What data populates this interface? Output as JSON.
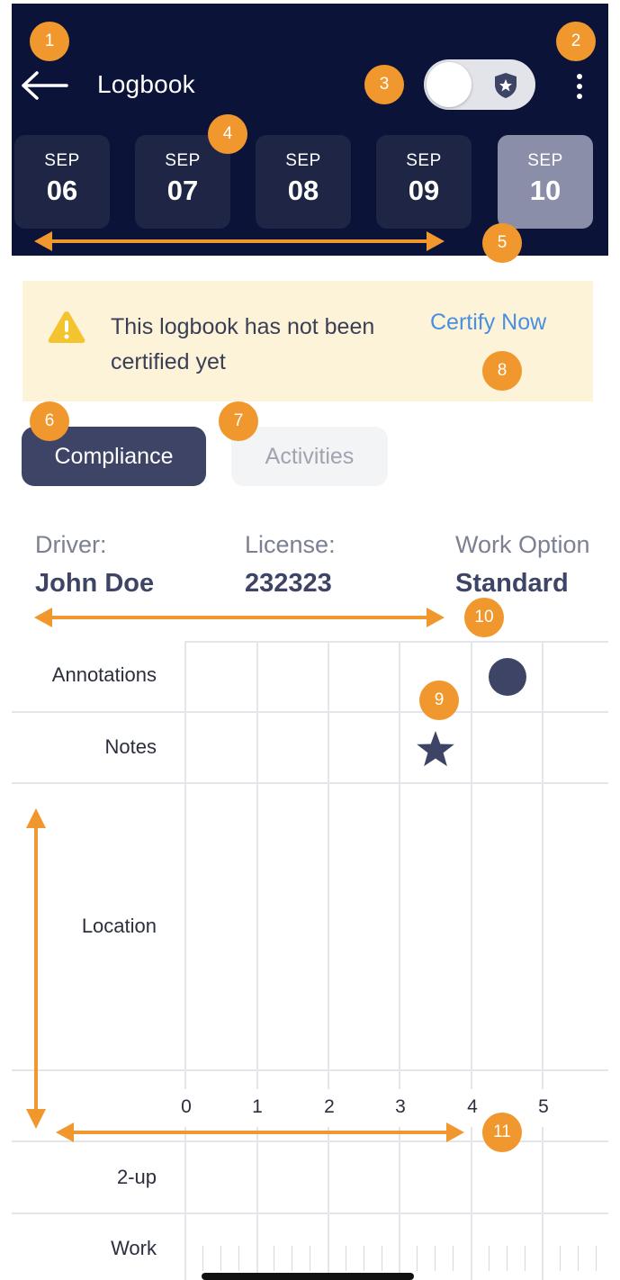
{
  "header": {
    "title": "Logbook",
    "bg_color": "#0c1338",
    "back_icon": "arrow-left-icon",
    "menu_icon": "kebab-menu-icon",
    "toggle": {
      "icon": "shield-star-icon",
      "state": "off"
    }
  },
  "dates": [
    {
      "month": "SEP",
      "day": "06",
      "selected": false
    },
    {
      "month": "SEP",
      "day": "07",
      "selected": false
    },
    {
      "month": "SEP",
      "day": "08",
      "selected": false
    },
    {
      "month": "SEP",
      "day": "09",
      "selected": false
    },
    {
      "month": "SEP",
      "day": "10",
      "selected": true
    }
  ],
  "banner": {
    "icon": "warning-icon",
    "message": "This logbook has not been certified yet",
    "action": "Certify Now",
    "bg_color": "#fcf3d9",
    "action_color": "#4a8fe0"
  },
  "tabs": [
    {
      "label": "Compliance",
      "active": true
    },
    {
      "label": "Activities",
      "active": false
    }
  ],
  "info": [
    {
      "label": "Driver:",
      "value": "John Doe"
    },
    {
      "label": "License:",
      "value": "232323"
    },
    {
      "label": "Work Option",
      "value": "Standard"
    }
  ],
  "grid": {
    "rows": [
      "Annotations",
      "Notes",
      "Location",
      "2-up",
      "Work"
    ],
    "hours": [
      "0",
      "1",
      "2",
      "3",
      "4",
      "5"
    ],
    "markers": [
      {
        "row": "Annotations",
        "hour": 4.5,
        "shape": "circle"
      },
      {
        "row": "Notes",
        "hour": 3.5,
        "shape": "star"
      }
    ]
  },
  "callouts": [
    "1",
    "2",
    "3",
    "4",
    "5",
    "6",
    "7",
    "8",
    "9",
    "10",
    "11"
  ],
  "accent_color": "#f0982d"
}
